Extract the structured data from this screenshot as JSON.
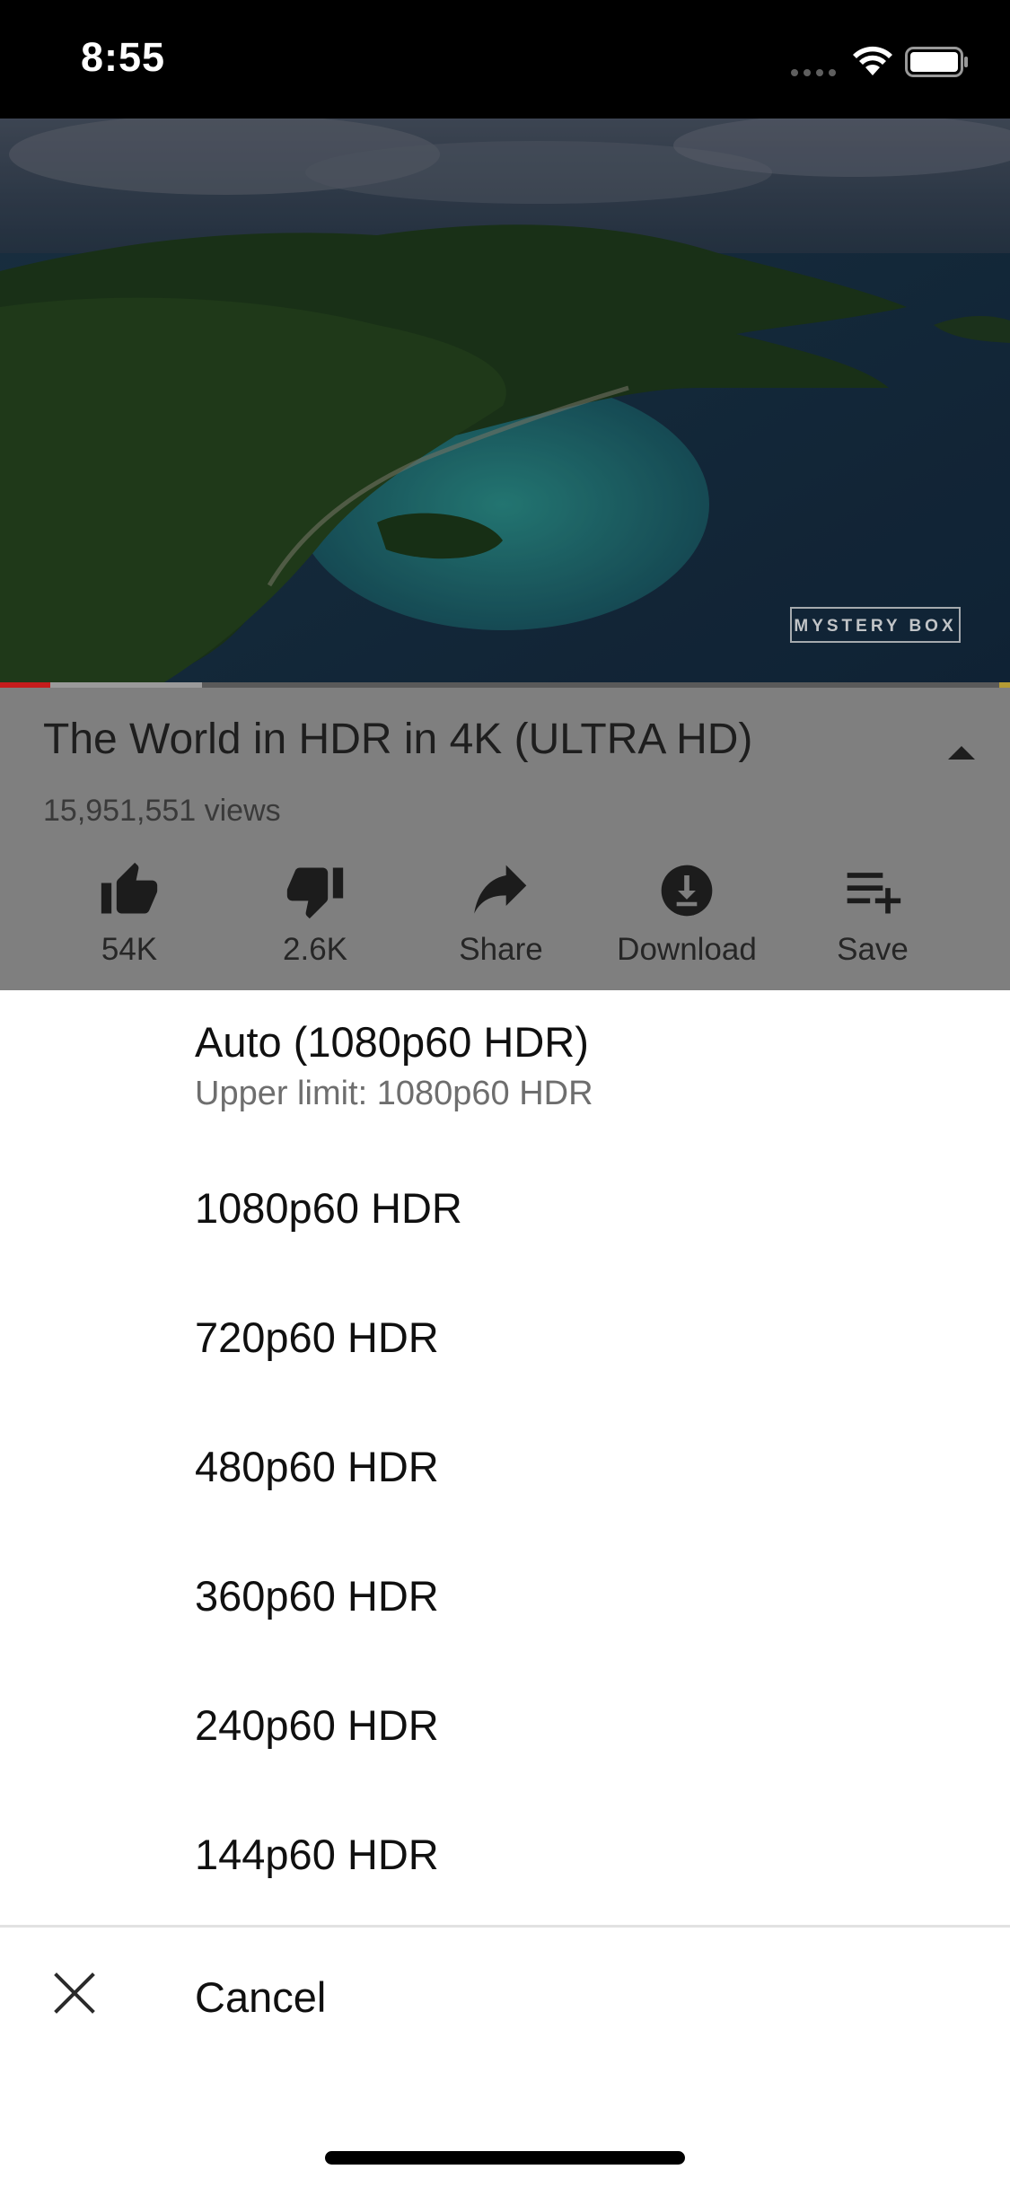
{
  "status_bar": {
    "time": "8:55"
  },
  "video": {
    "watermark": "MYSTERY BOX",
    "progress_fraction": 0.05,
    "buffer_fraction": 0.2
  },
  "info": {
    "title": "The World in HDR in 4K (ULTRA HD)",
    "views": "15,951,551 views",
    "actions": [
      {
        "label": "54K",
        "icon": "thumbs-up-icon"
      },
      {
        "label": "2.6K",
        "icon": "thumbs-down-icon"
      },
      {
        "label": "Share",
        "icon": "share-icon"
      },
      {
        "label": "Download",
        "icon": "download-icon"
      },
      {
        "label": "Save",
        "icon": "playlist-add-icon"
      }
    ]
  },
  "quality_menu": {
    "options": [
      {
        "label": "Auto (1080p60 HDR)",
        "sublabel": "Upper limit: 1080p60 HDR"
      },
      {
        "label": "1080p60 HDR"
      },
      {
        "label": "720p60 HDR"
      },
      {
        "label": "480p60 HDR"
      },
      {
        "label": "360p60 HDR"
      },
      {
        "label": "240p60 HDR"
      },
      {
        "label": "144p60 HDR"
      }
    ],
    "cancel_label": "Cancel"
  },
  "colors": {
    "status_bar_bg": "#000000",
    "overlay_dim": "#7f7f7f",
    "progress_played": "#c61c1c",
    "sheet_bg": "#ffffff"
  }
}
